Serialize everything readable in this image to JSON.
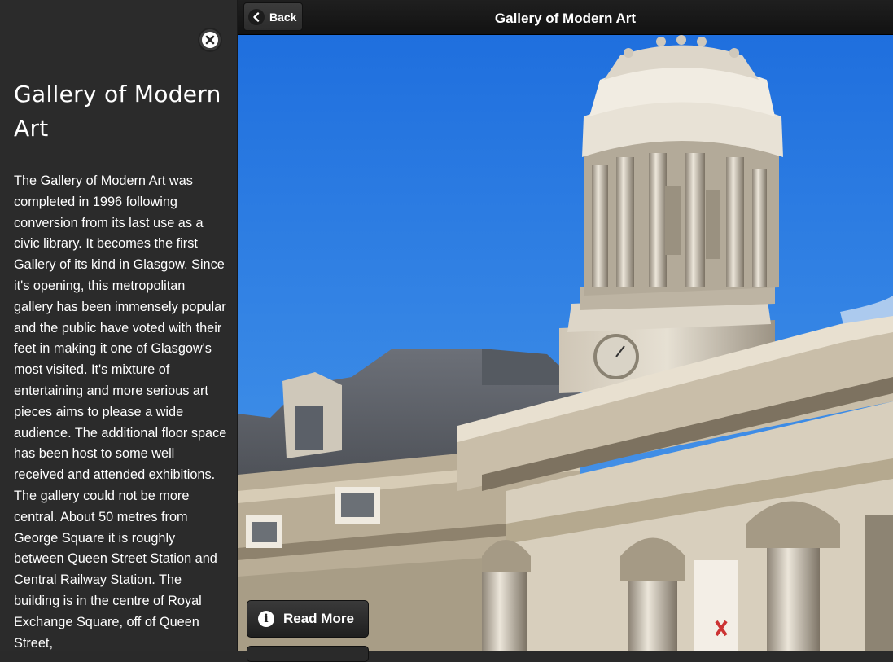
{
  "header": {
    "back_label": "Back",
    "title": "Gallery of Modern Art"
  },
  "panel": {
    "title": "Gallery of Modern Art",
    "body": "The Gallery of Modern Art was completed in 1996 following conversion from its last use as a civic library. It becomes the first Gallery of its kind in Glasgow. Since it's opening, this metropolitan gallery has been immensely popular and the public have voted with their feet in making it one of Glasgow's most visited. It's mixture of entertaining and more serious art pieces aims to please a wide audience. The additional floor space has been host to some well received and attended exhibitions. The gallery could not be more central. About 50 metres from George Square it is roughly between Queen Street Station and Central Railway Station. The building is in the centre of Royal Exchange Square, off of Queen Street,"
  },
  "actions": {
    "read_more_label": "Read More"
  },
  "icons": {
    "close": "close-icon",
    "back": "chevron-left-icon",
    "info": "info-icon"
  },
  "colors": {
    "panel_bg": "#2b2b2b",
    "header_bg": "#151515",
    "sky": "#2f7fe0"
  }
}
